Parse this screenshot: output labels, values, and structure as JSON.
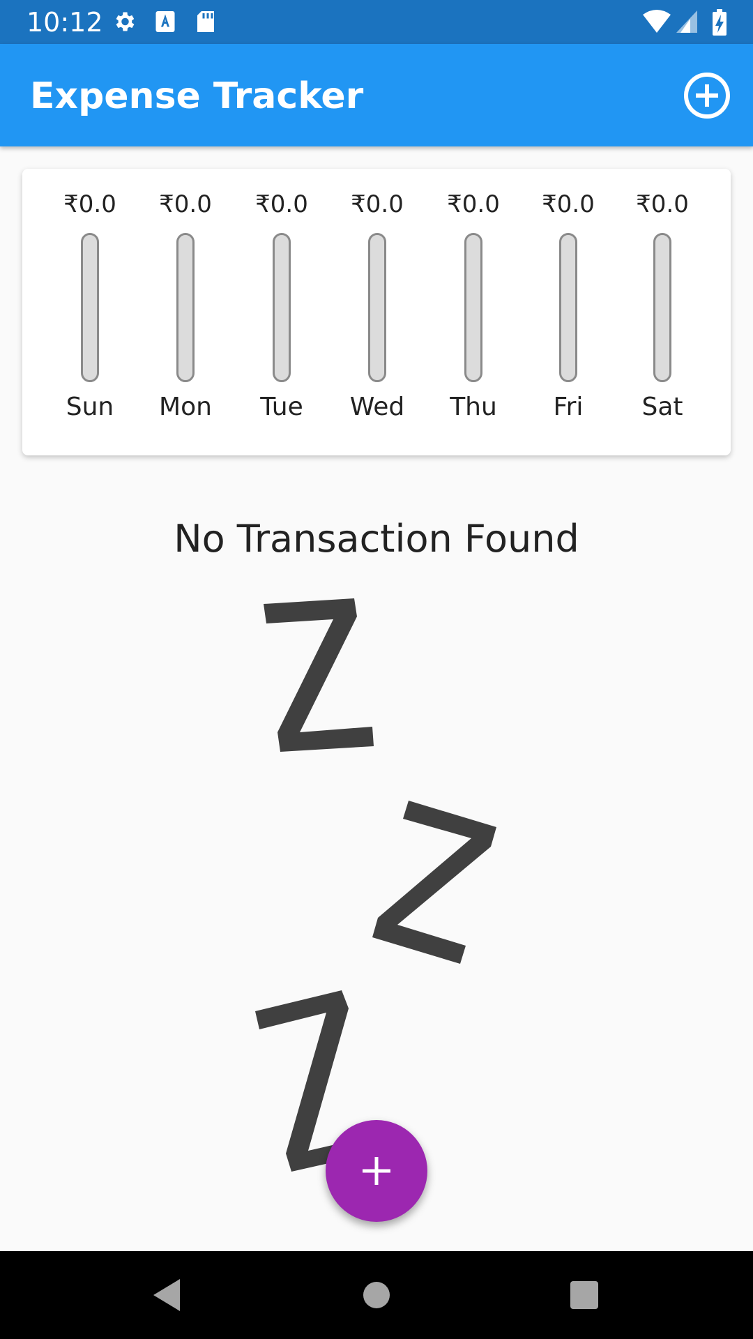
{
  "status_bar": {
    "time": "10:12",
    "icons": [
      "settings-icon",
      "a-badge-icon",
      "sd-card-icon",
      "wifi-icon",
      "cell-signal-icon",
      "battery-charging-icon"
    ]
  },
  "app_bar": {
    "title": "Expense Tracker",
    "action_icon": "add-circle-outline-icon",
    "color": "#2196f3"
  },
  "weekly_chart": {
    "days": [
      {
        "amount": "₹0.0",
        "label": "Sun",
        "fraction": 0
      },
      {
        "amount": "₹0.0",
        "label": "Mon",
        "fraction": 0
      },
      {
        "amount": "₹0.0",
        "label": "Tue",
        "fraction": 0
      },
      {
        "amount": "₹0.0",
        "label": "Wed",
        "fraction": 0
      },
      {
        "amount": "₹0.0",
        "label": "Thu",
        "fraction": 0
      },
      {
        "amount": "₹0.0",
        "label": "Fri",
        "fraction": 0
      },
      {
        "amount": "₹0.0",
        "label": "Sat",
        "fraction": 0
      }
    ]
  },
  "empty_state": {
    "message": "No Transaction Found",
    "image": "sleeping-zzz-icon"
  },
  "fab": {
    "icon": "plus-icon",
    "color": "#9c27b0"
  },
  "nav_bar": {
    "buttons": [
      "back-triangle-icon",
      "home-circle-icon",
      "recents-square-icon"
    ]
  }
}
